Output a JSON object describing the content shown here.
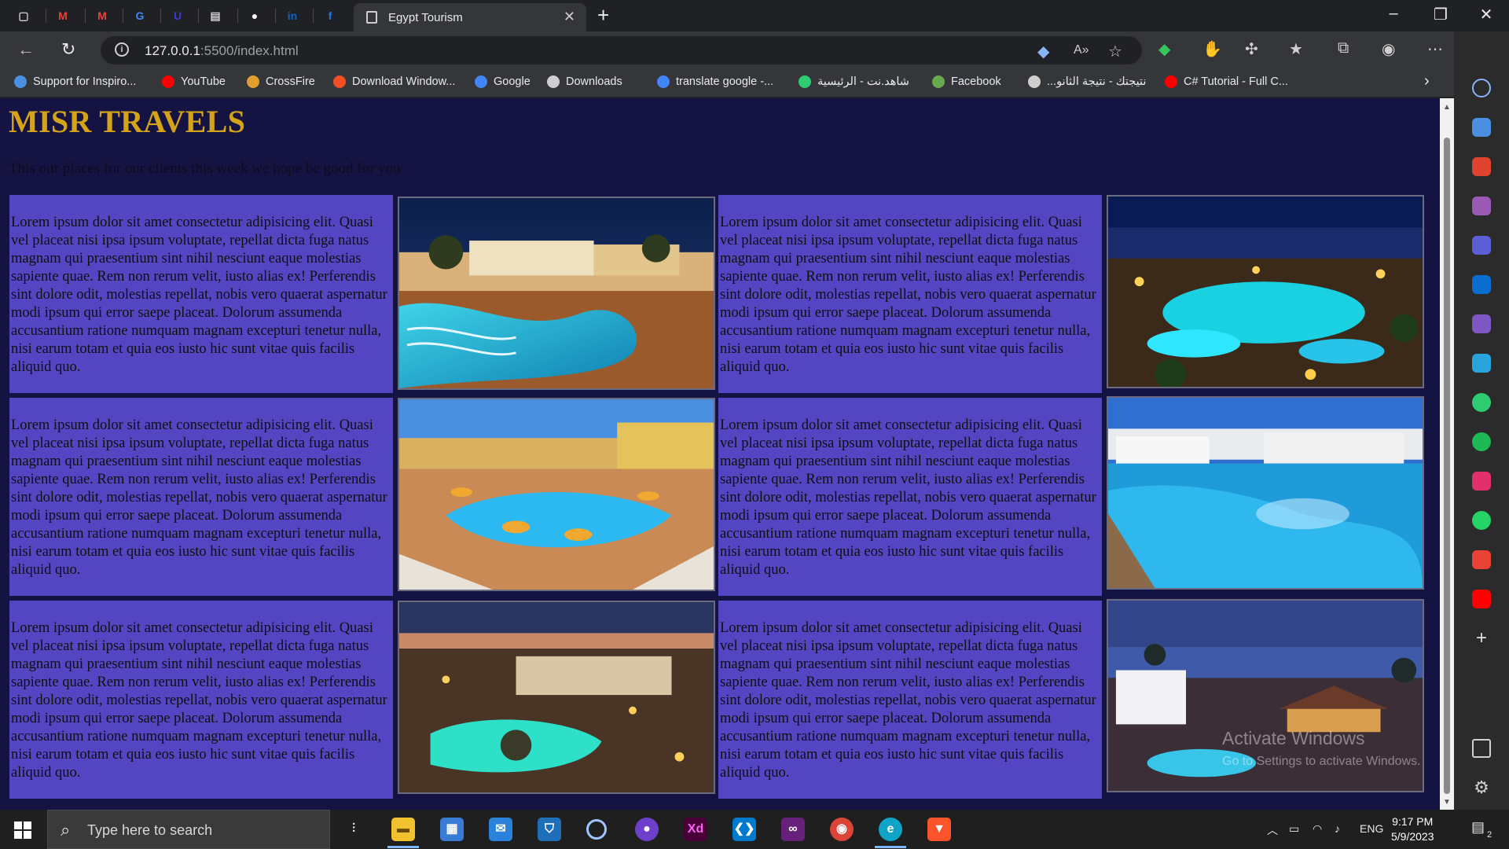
{
  "browser": {
    "tab_favicons": [
      {
        "name": "tab-icon-tabs",
        "color": "#cfcfcf",
        "glyph": "▢"
      },
      {
        "name": "gmail-icon",
        "color": "#ea4335",
        "glyph": "M"
      },
      {
        "name": "gmail-icon",
        "color": "#ea4335",
        "glyph": "M"
      },
      {
        "name": "google-icon",
        "color": "#4285f4",
        "glyph": "G"
      },
      {
        "name": "tab-icon-u",
        "color": "#3b3bd6",
        "glyph": "U"
      },
      {
        "name": "tab-icon-doc",
        "color": "#cfcfcf",
        "glyph": "▤"
      },
      {
        "name": "github-icon",
        "color": "#ffffff",
        "glyph": "●"
      },
      {
        "name": "linkedin-icon",
        "color": "#0a66c2",
        "glyph": "in"
      },
      {
        "name": "facebook-icon",
        "color": "#1877f2",
        "glyph": "f"
      }
    ],
    "active_tab_title": "Egypt Tourism",
    "url_host": "127.0.0.1",
    "url_path": ":5500/index.html",
    "bookmarks": [
      {
        "label": "Support for Inspiro...",
        "color": "#4a90e2"
      },
      {
        "label": "YouTube",
        "color": "#ff0000"
      },
      {
        "label": "CrossFire",
        "color": "#e0a030"
      },
      {
        "label": "Download Window...",
        "color": "#f25022"
      },
      {
        "label": "Google",
        "color": "#4285f4"
      },
      {
        "label": "Downloads",
        "color": "#cfcfcf"
      },
      {
        "label": "translate google -...",
        "color": "#4285f4"
      },
      {
        "label": "شاهد.نت - الرئيسية",
        "color": "#2ecc71"
      },
      {
        "label": "Facebook",
        "color": "#6aa84f"
      },
      {
        "label": "...نتيجتك - نتيجة الثانو",
        "color": "#cfcfcf"
      },
      {
        "label": "C# Tutorial - Full C...",
        "color": "#ff0000"
      }
    ]
  },
  "page": {
    "title": "MISR TRAVELS",
    "subtitle": "This our places for our clients this week we hope be good for you",
    "card_text": "Lorem ipsum dolor sit amet consectetur adipisicing elit. Quasi vel placeat nisi ipsa ipsum voluptate, repellat dicta fuga natus magnam qui praesentium sint nihil nesciunt eaque molestias sapiente quae. Rem non rerum velit, iusto alias ex! Perferendis sint dolore odit, molestias repellat, nobis vero quaerat aspernatur modi ipsum qui error saepe placeat. Dolorum assumenda accusantium ratione numquam magnam excepturi tenetur nulla, nisi earum totam et quia eos iusto hic sunt vitae quis facilis aliquid quo.",
    "photos": [
      {
        "name": "resort-pool-night-photo"
      },
      {
        "name": "resort-aerial-night-photo"
      },
      {
        "name": "resort-pool-umbrellas-photo"
      },
      {
        "name": "resort-pool-day-photo"
      },
      {
        "name": "resort-dusk-pool-photo"
      },
      {
        "name": "resort-beach-dusk-photo"
      }
    ],
    "colors": {
      "background": "#141342",
      "title": "#d4a31a",
      "card": "#5446c2"
    }
  },
  "watermark": {
    "line1": "Activate Windows",
    "line2": "Go to Settings to activate Windows."
  },
  "taskbar": {
    "search_placeholder": "Type here to search",
    "language": "ENG",
    "time": "9:17 PM",
    "date": "5/9/2023",
    "notification_count": "2"
  }
}
